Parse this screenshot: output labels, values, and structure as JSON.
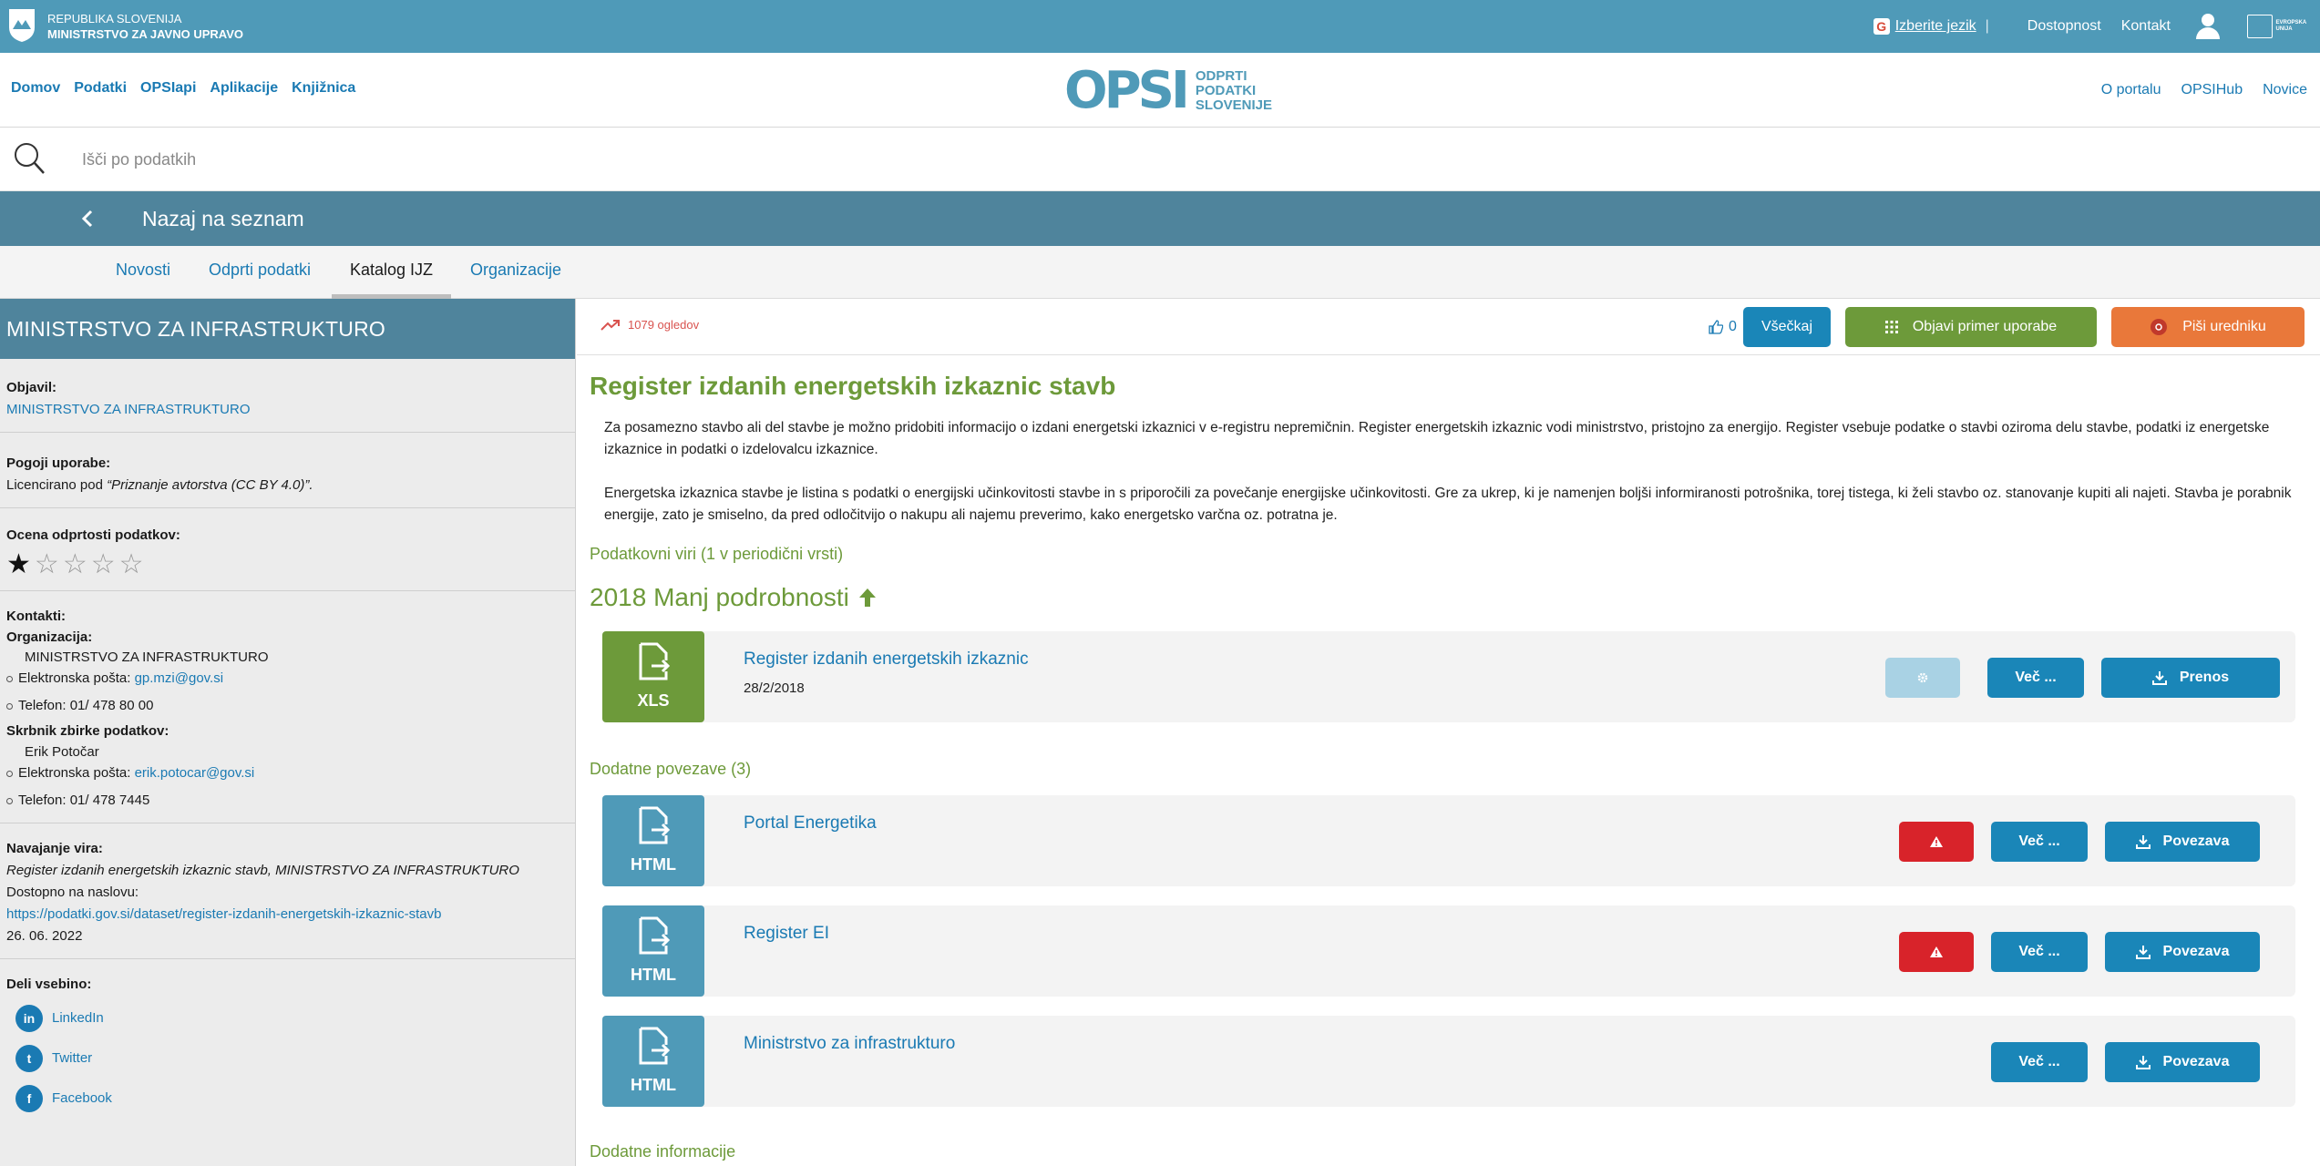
{
  "topbar": {
    "gov_line1": "REPUBLIKA SLOVENIJA",
    "gov_line2": "MINISTRSTVO ZA JAVNO UPRAVO",
    "lang_label": "Izberite jezik",
    "lang_sep": "|",
    "accessibility": "Dostopnost",
    "contact": "Kontakt",
    "eu_text": "EVROPSKA UNIJA"
  },
  "nav": {
    "left": [
      "Domov",
      "Podatki",
      "OPSIapi",
      "Aplikacije",
      "Knjižnica"
    ],
    "brand_mark": "OPSI",
    "brand_sub": [
      "ODPRTI",
      "PODATKI",
      "SLOVENIJE"
    ],
    "right": [
      "O portalu",
      "OPSIHub",
      "Novice"
    ]
  },
  "search": {
    "placeholder": "Išči po podatkih"
  },
  "backbar": {
    "label": "Nazaj na seznam"
  },
  "tabs": [
    "Novosti",
    "Odprti podatki",
    "Katalog IJZ",
    "Organizacije"
  ],
  "sidebar": {
    "header": "MINISTRSTVO ZA INFRASTRUKTURO",
    "published_by_label": "Objavil:",
    "published_by": "MINISTRSTVO ZA INFRASTRUKTURO",
    "terms_label": "Pogoji uporabe:",
    "terms_prefix": "Licencirano pod ",
    "terms_license": "“Priznanje avtorstva (CC BY 4.0)”.",
    "rating_label": "Ocena odprtosti podatkov:",
    "rating": 1,
    "rating_max": 5,
    "contacts_label": "Kontakti:",
    "org_label": "Organizacija:",
    "org_name": "MINISTRSTVO ZA INFRASTRUKTURO",
    "email_label": "Elektronska pošta: ",
    "org_email": "gp.mzi@gov.si",
    "org_phone": "Telefon: 01/ 478 80 00",
    "custodian_label": "Skrbnik zbirke podatkov:",
    "custodian_name": "Erik Potočar",
    "custodian_email": "erik.potocar@gov.si",
    "custodian_phone": "Telefon: 01/ 478 7445",
    "citation_label": "Navajanje vira:",
    "citation_text": "Register izdanih energetskih izkaznic stavb, MINISTRSTVO ZA INFRASTRUKTURO",
    "available_label": "Dostopno na naslovu:",
    "citation_url": "https://podatki.gov.si/dataset/register-izdanih-energetskih-izkaznic-stavb",
    "citation_date": "26. 06. 2022",
    "share_label": "Deli vsebino:",
    "share": [
      {
        "icon": "in",
        "label": "LinkedIn"
      },
      {
        "icon": "t",
        "label": "Twitter"
      },
      {
        "icon": "f",
        "label": "Facebook"
      }
    ]
  },
  "main": {
    "views": "1079 ogledov",
    "likes": "0",
    "like_btn": "Všečkaj",
    "publish_btn": "Objavi primer uporabe",
    "write_btn": "Piši uredniku",
    "title": "Register izdanih energetskih izkaznic stavb",
    "desc1": "Za posamezno stavbo ali del stavbe je možno pridobiti informacijo o izdani energetski izkaznici v e-registru nepremičnin. Register energetskih izkaznic vodi ministrstvo, pristojno za energijo. Register vsebuje podatke o stavbi oziroma delu stavbe, podatki iz energetske izkaznice in podatki o izdelovalcu izkaznice.",
    "desc2": "Energetska izkaznica stavbe je listina s podatki o energijski učinkovitosti stavbe in s priporočili za povečanje energijske učinkovitosti. Gre za ukrep, ki je namenjen boljši informiranosti potrošnika, torej tistega, ki želi stavbo oz. stanovanje kupiti ali najeti. Stavba je porabnik energije, zato je smiselno, da pred odločitvijo o nakupu ali najemu preverimo, kako energetsko varčna oz. potratna je.",
    "resources_head": "Podatkovni viri (1 v periodični vrsti)",
    "year_label": "2018 Manj podrobnosti",
    "resource": {
      "format": "XLS",
      "title": "Register izdanih energetskih izkaznic",
      "date": "28/2/2018",
      "more": "Več ...",
      "download": "Prenos"
    },
    "links_head": "Dodatne povezave (3)",
    "links": [
      {
        "format": "HTML",
        "title": "Portal Energetika",
        "warn": true,
        "more": "Več ...",
        "link": "Povezava"
      },
      {
        "format": "HTML",
        "title": "Register EI",
        "warn": true,
        "more": "Več ...",
        "link": "Povezava"
      },
      {
        "format": "HTML",
        "title": "Ministrstvo za infrastrukturo",
        "warn": false,
        "more": "Več ...",
        "link": "Povezava"
      }
    ],
    "additional_head": "Dodatne informacije"
  }
}
